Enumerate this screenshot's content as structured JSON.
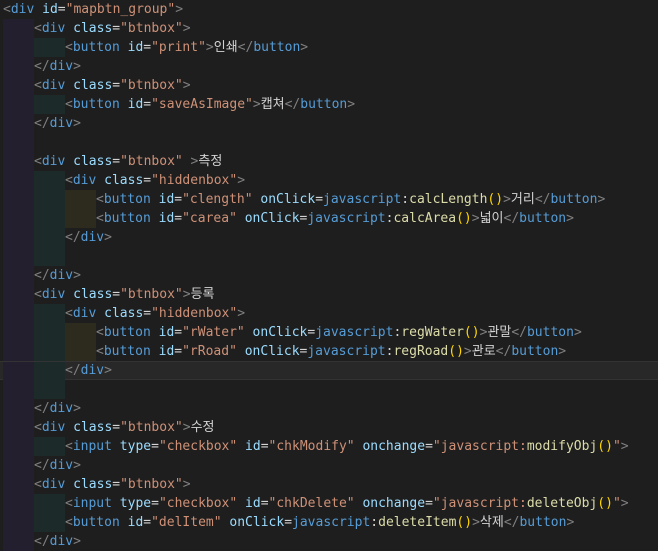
{
  "editor": {
    "lines": [
      {
        "indent": 0,
        "guides": [],
        "tokens": [
          [
            "pc",
            "<"
          ],
          [
            "tg",
            "div"
          ],
          [
            "at",
            " id"
          ],
          [
            "tx",
            "="
          ],
          [
            "st",
            "\"mapbtn_group\""
          ],
          [
            "pc",
            ">"
          ]
        ]
      },
      {
        "indent": 1,
        "guides": [
          0
        ],
        "tokens": [
          [
            "pc",
            "<"
          ],
          [
            "tg",
            "div"
          ],
          [
            "at",
            " class"
          ],
          [
            "tx",
            "="
          ],
          [
            "st",
            "\"btnbox\""
          ],
          [
            "pc",
            ">"
          ]
        ]
      },
      {
        "indent": 2,
        "guides": [
          0,
          1
        ],
        "tokens": [
          [
            "pc",
            "<"
          ],
          [
            "tg",
            "button"
          ],
          [
            "at",
            " id"
          ],
          [
            "tx",
            "="
          ],
          [
            "st",
            "\"print\""
          ],
          [
            "pc",
            ">"
          ],
          [
            "tx",
            "인쇄"
          ],
          [
            "pc",
            "</"
          ],
          [
            "tg",
            "button"
          ],
          [
            "pc",
            ">"
          ]
        ]
      },
      {
        "indent": 1,
        "guides": [
          0
        ],
        "tokens": [
          [
            "pc",
            "</"
          ],
          [
            "tg",
            "div"
          ],
          [
            "pc",
            ">"
          ]
        ]
      },
      {
        "indent": 1,
        "guides": [
          0
        ],
        "tokens": [
          [
            "pc",
            "<"
          ],
          [
            "tg",
            "div"
          ],
          [
            "at",
            " class"
          ],
          [
            "tx",
            "="
          ],
          [
            "st",
            "\"btnbox\""
          ],
          [
            "pc",
            ">"
          ]
        ]
      },
      {
        "indent": 2,
        "guides": [
          0,
          1
        ],
        "tokens": [
          [
            "pc",
            "<"
          ],
          [
            "tg",
            "button"
          ],
          [
            "at",
            " id"
          ],
          [
            "tx",
            "="
          ],
          [
            "st",
            "\"saveAsImage\""
          ],
          [
            "pc",
            ">"
          ],
          [
            "tx",
            "캡쳐"
          ],
          [
            "pc",
            "</"
          ],
          [
            "tg",
            "button"
          ],
          [
            "pc",
            ">"
          ]
        ]
      },
      {
        "indent": 1,
        "guides": [
          0
        ],
        "tokens": [
          [
            "pc",
            "</"
          ],
          [
            "tg",
            "div"
          ],
          [
            "pc",
            ">"
          ]
        ]
      },
      {
        "indent": 0,
        "guides": [
          0
        ],
        "tokens": []
      },
      {
        "indent": 1,
        "guides": [
          0
        ],
        "tokens": [
          [
            "pc",
            "<"
          ],
          [
            "tg",
            "div"
          ],
          [
            "at",
            " class"
          ],
          [
            "tx",
            "="
          ],
          [
            "st",
            "\"btnbox\""
          ],
          [
            "pc",
            " >"
          ],
          [
            "tx",
            "측정"
          ]
        ]
      },
      {
        "indent": 2,
        "guides": [
          0,
          1
        ],
        "tokens": [
          [
            "pc",
            "<"
          ],
          [
            "tg",
            "div"
          ],
          [
            "at",
            " class"
          ],
          [
            "tx",
            "="
          ],
          [
            "st",
            "\"hiddenbox\""
          ],
          [
            "pc",
            ">"
          ]
        ]
      },
      {
        "indent": 3,
        "guides": [
          0,
          1,
          2
        ],
        "tokens": [
          [
            "pc",
            "<"
          ],
          [
            "tg",
            "button"
          ],
          [
            "at",
            " id"
          ],
          [
            "tx",
            "="
          ],
          [
            "st",
            "\"clength\""
          ],
          [
            "at",
            " onClick"
          ],
          [
            "tx",
            "="
          ],
          [
            "tg",
            "javascript"
          ],
          [
            "tx",
            ":"
          ],
          [
            "fn",
            "calcLength"
          ],
          [
            "pn",
            "()"
          ],
          [
            "pc",
            ">"
          ],
          [
            "tx",
            "거리"
          ],
          [
            "pc",
            "</"
          ],
          [
            "tg",
            "button"
          ],
          [
            "pc",
            ">"
          ]
        ]
      },
      {
        "indent": 3,
        "guides": [
          0,
          1,
          2
        ],
        "tokens": [
          [
            "pc",
            "<"
          ],
          [
            "tg",
            "button"
          ],
          [
            "at",
            " id"
          ],
          [
            "tx",
            "="
          ],
          [
            "st",
            "\"carea\""
          ],
          [
            "at",
            " onClick"
          ],
          [
            "tx",
            "="
          ],
          [
            "tg",
            "javascript"
          ],
          [
            "tx",
            ":"
          ],
          [
            "fn",
            "calcArea"
          ],
          [
            "pn",
            "()"
          ],
          [
            "pc",
            ">"
          ],
          [
            "tx",
            "넓이"
          ],
          [
            "pc",
            "</"
          ],
          [
            "tg",
            "button"
          ],
          [
            "pc",
            ">"
          ]
        ]
      },
      {
        "indent": 2,
        "guides": [
          0,
          1
        ],
        "tokens": [
          [
            "pc",
            "</"
          ],
          [
            "tg",
            "div"
          ],
          [
            "pc",
            ">"
          ]
        ]
      },
      {
        "indent": 0,
        "guides": [
          0,
          1
        ],
        "tokens": []
      },
      {
        "indent": 1,
        "guides": [
          0
        ],
        "tokens": [
          [
            "pc",
            "</"
          ],
          [
            "tg",
            "div"
          ],
          [
            "pc",
            ">"
          ]
        ]
      },
      {
        "indent": 1,
        "guides": [
          0
        ],
        "tokens": [
          [
            "pc",
            "<"
          ],
          [
            "tg",
            "div"
          ],
          [
            "at",
            " class"
          ],
          [
            "tx",
            "="
          ],
          [
            "st",
            "\"btnbox\""
          ],
          [
            "pc",
            ">"
          ],
          [
            "tx",
            "등록"
          ]
        ]
      },
      {
        "indent": 2,
        "guides": [
          0,
          1
        ],
        "tokens": [
          [
            "pc",
            "<"
          ],
          [
            "tg",
            "div"
          ],
          [
            "at",
            " class"
          ],
          [
            "tx",
            "="
          ],
          [
            "st",
            "\"hiddenbox\""
          ],
          [
            "pc",
            ">"
          ]
        ]
      },
      {
        "indent": 3,
        "guides": [
          0,
          1,
          2
        ],
        "tokens": [
          [
            "pc",
            "<"
          ],
          [
            "tg",
            "button"
          ],
          [
            "at",
            " id"
          ],
          [
            "tx",
            "="
          ],
          [
            "st",
            "\"rWater\""
          ],
          [
            "at",
            " onClick"
          ],
          [
            "tx",
            "="
          ],
          [
            "tg",
            "javascript"
          ],
          [
            "tx",
            ":"
          ],
          [
            "fn",
            "regWater"
          ],
          [
            "pn",
            "()"
          ],
          [
            "pc",
            ">"
          ],
          [
            "tx",
            "관말"
          ],
          [
            "pc",
            "</"
          ],
          [
            "tg",
            "button"
          ],
          [
            "pc",
            ">"
          ]
        ]
      },
      {
        "indent": 3,
        "guides": [
          0,
          1,
          2
        ],
        "tokens": [
          [
            "pc",
            "<"
          ],
          [
            "tg",
            "button"
          ],
          [
            "at",
            " id"
          ],
          [
            "tx",
            "="
          ],
          [
            "st",
            "\"rRoad\""
          ],
          [
            "at",
            " onClick"
          ],
          [
            "tx",
            "="
          ],
          [
            "tg",
            "javascript"
          ],
          [
            "tx",
            ":"
          ],
          [
            "fn",
            "regRoad"
          ],
          [
            "pn",
            "()"
          ],
          [
            "pc",
            ">"
          ],
          [
            "tx",
            "관로"
          ],
          [
            "pc",
            "</"
          ],
          [
            "tg",
            "button"
          ],
          [
            "pc",
            ">"
          ]
        ]
      },
      {
        "indent": 2,
        "guides": [
          0,
          1
        ],
        "tokens": [
          [
            "pc",
            "</"
          ],
          [
            "tg",
            "div"
          ],
          [
            "pc",
            ">"
          ]
        ],
        "current": true
      },
      {
        "indent": 0,
        "guides": [
          0,
          1
        ],
        "tokens": []
      },
      {
        "indent": 1,
        "guides": [
          0
        ],
        "tokens": [
          [
            "pc",
            "</"
          ],
          [
            "tg",
            "div"
          ],
          [
            "pc",
            ">"
          ]
        ]
      },
      {
        "indent": 1,
        "guides": [
          0
        ],
        "tokens": [
          [
            "pc",
            "<"
          ],
          [
            "tg",
            "div"
          ],
          [
            "at",
            " class"
          ],
          [
            "tx",
            "="
          ],
          [
            "st",
            "\"btnbox\""
          ],
          [
            "pc",
            ">"
          ],
          [
            "tx",
            "수정"
          ]
        ]
      },
      {
        "indent": 2,
        "guides": [
          0,
          1
        ],
        "tokens": [
          [
            "pc",
            "<"
          ],
          [
            "tg",
            "input"
          ],
          [
            "at",
            " type"
          ],
          [
            "tx",
            "="
          ],
          [
            "st",
            "\"checkbox\""
          ],
          [
            "at",
            " id"
          ],
          [
            "tx",
            "="
          ],
          [
            "st",
            "\"chkModify\""
          ],
          [
            "at",
            " onchange"
          ],
          [
            "tx",
            "="
          ],
          [
            "st",
            "\"javascript:"
          ],
          [
            "fn",
            "modifyObj"
          ],
          [
            "pn",
            "()"
          ],
          [
            "st",
            "\""
          ],
          [
            "pc",
            ">"
          ]
        ]
      },
      {
        "indent": 1,
        "guides": [
          0
        ],
        "tokens": [
          [
            "pc",
            "</"
          ],
          [
            "tg",
            "div"
          ],
          [
            "pc",
            ">"
          ]
        ]
      },
      {
        "indent": 1,
        "guides": [
          0
        ],
        "tokens": [
          [
            "pc",
            "<"
          ],
          [
            "tg",
            "div"
          ],
          [
            "at",
            " class"
          ],
          [
            "tx",
            "="
          ],
          [
            "st",
            "\"btnbox\""
          ],
          [
            "pc",
            ">"
          ]
        ]
      },
      {
        "indent": 2,
        "guides": [
          0,
          1
        ],
        "tokens": [
          [
            "pc",
            "<"
          ],
          [
            "tg",
            "input"
          ],
          [
            "at",
            " type"
          ],
          [
            "tx",
            "="
          ],
          [
            "st",
            "\"checkbox\""
          ],
          [
            "at",
            " id"
          ],
          [
            "tx",
            "="
          ],
          [
            "st",
            "\"chkDelete\""
          ],
          [
            "at",
            " onchange"
          ],
          [
            "tx",
            "="
          ],
          [
            "st",
            "\"javascript:"
          ],
          [
            "fn",
            "deleteObj"
          ],
          [
            "pn",
            "()"
          ],
          [
            "st",
            "\""
          ],
          [
            "pc",
            ">"
          ]
        ]
      },
      {
        "indent": 2,
        "guides": [
          0,
          1
        ],
        "tokens": [
          [
            "pc",
            "<"
          ],
          [
            "tg",
            "button"
          ],
          [
            "at",
            " id"
          ],
          [
            "tx",
            "="
          ],
          [
            "st",
            "\"delItem\""
          ],
          [
            "at",
            " onClick"
          ],
          [
            "tx",
            "="
          ],
          [
            "tg",
            "javascript"
          ],
          [
            "tx",
            ":"
          ],
          [
            "fn",
            "deleteItem"
          ],
          [
            "pn",
            "()"
          ],
          [
            "pc",
            ">"
          ],
          [
            "tx",
            "삭제"
          ],
          [
            "pc",
            "</"
          ],
          [
            "tg",
            "button"
          ],
          [
            "pc",
            ">"
          ]
        ]
      },
      {
        "indent": 1,
        "guides": [
          0
        ],
        "tokens": [
          [
            "pc",
            "</"
          ],
          [
            "tg",
            "div"
          ],
          [
            "pc",
            ">"
          ]
        ]
      }
    ]
  }
}
